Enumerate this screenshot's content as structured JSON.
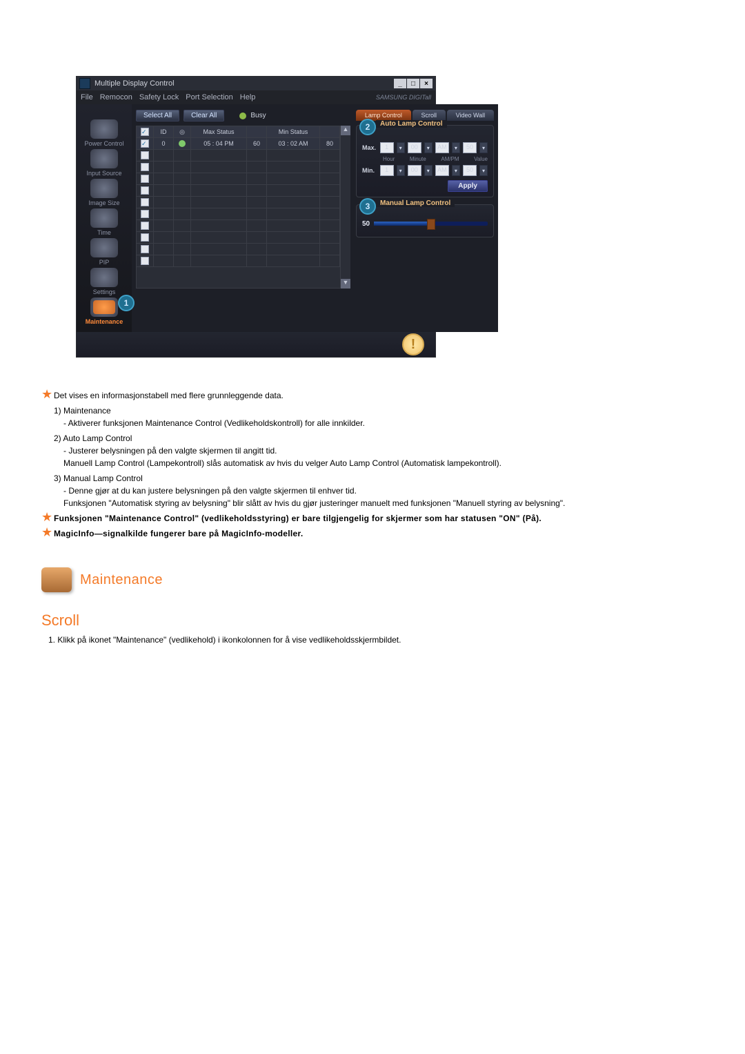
{
  "window": {
    "title": "Multiple Display Control",
    "menus": [
      "File",
      "Remocon",
      "Safety Lock",
      "Port Selection",
      "Help"
    ],
    "brand": "SAMSUNG DIGITall"
  },
  "sidebar": {
    "items": [
      {
        "label": "Power Control"
      },
      {
        "label": "Input Source"
      },
      {
        "label": "Image Size"
      },
      {
        "label": "Time"
      },
      {
        "label": "PIP"
      },
      {
        "label": "Settings"
      },
      {
        "label": "Maintenance",
        "active": true,
        "callout": "1"
      }
    ]
  },
  "toolbar": {
    "select_all": "Select All",
    "clear_all": "Clear All",
    "busy": "Busy"
  },
  "grid": {
    "headers": {
      "id": "ID",
      "maxstatus": "Max Status",
      "minstatus": "Min Status"
    },
    "row": {
      "id": "0",
      "max_status": "05 : 04 PM",
      "max_value": "60",
      "min_status": "03 : 02 AM",
      "min_value": "80"
    }
  },
  "right": {
    "tabs": {
      "lamp": "Lamp Control",
      "scroll": "Scroll",
      "videowall": "Video Wall"
    },
    "auto": {
      "title": "Auto Lamp Control",
      "callout": "2",
      "sublabels": {
        "hour": "Hour",
        "minute": "Minute",
        "ampm": "AM/PM",
        "value": "Value"
      },
      "rows": {
        "max": {
          "label": "Max.",
          "hour": "1",
          "minute": "00",
          "ampm": "AM",
          "value": "50"
        },
        "min": {
          "label": "Min.",
          "hour": "1",
          "minute": "00",
          "ampm": "AM",
          "value": "50"
        }
      },
      "apply": "Apply"
    },
    "manual": {
      "title": "Manual Lamp Control",
      "callout": "3",
      "value": "50"
    }
  },
  "notes": {
    "intro": "Det vises en informasjonstabell med flere grunnleggende data.",
    "items": [
      {
        "num": "1)",
        "title": "Maintenance",
        "desc": "- Aktiverer funksjonen Maintenance Control (Vedlikeholdskontroll) for alle innkilder."
      },
      {
        "num": "2)",
        "title": "Auto Lamp Control",
        "desc": "- Justerer belysningen på den valgte skjermen til angitt tid.\nManuell Lamp Control (Lampekontroll) slås automatisk av hvis du velger Auto Lamp Control (Automatisk lampekontroll)."
      },
      {
        "num": "3)",
        "title": "Manual Lamp Control",
        "desc": "- Denne gjør at du kan justere belysningen på den valgte skjermen til enhver tid.\nFunksjonen \"Automatisk styring av belysning\" blir slått av hvis du gjør justeringer manuelt med funksjonen \"Manuell styring av belysning\"."
      }
    ],
    "bold1": "Funksjonen \"Maintenance Control\" (vedlikeholdsstyring) er bare tilgjengelig for skjermer som har statusen \"ON\" (På).",
    "bold2": "MagicInfo—signalkilde fungerer bare på MagicInfo-modeller."
  },
  "section": {
    "title": "Maintenance",
    "sub": "Scroll",
    "step1": "1. Klikk på ikonet \"Maintenance\" (vedlikehold) i ikonkolonnen for å vise vedlikeholdsskjermbildet."
  }
}
